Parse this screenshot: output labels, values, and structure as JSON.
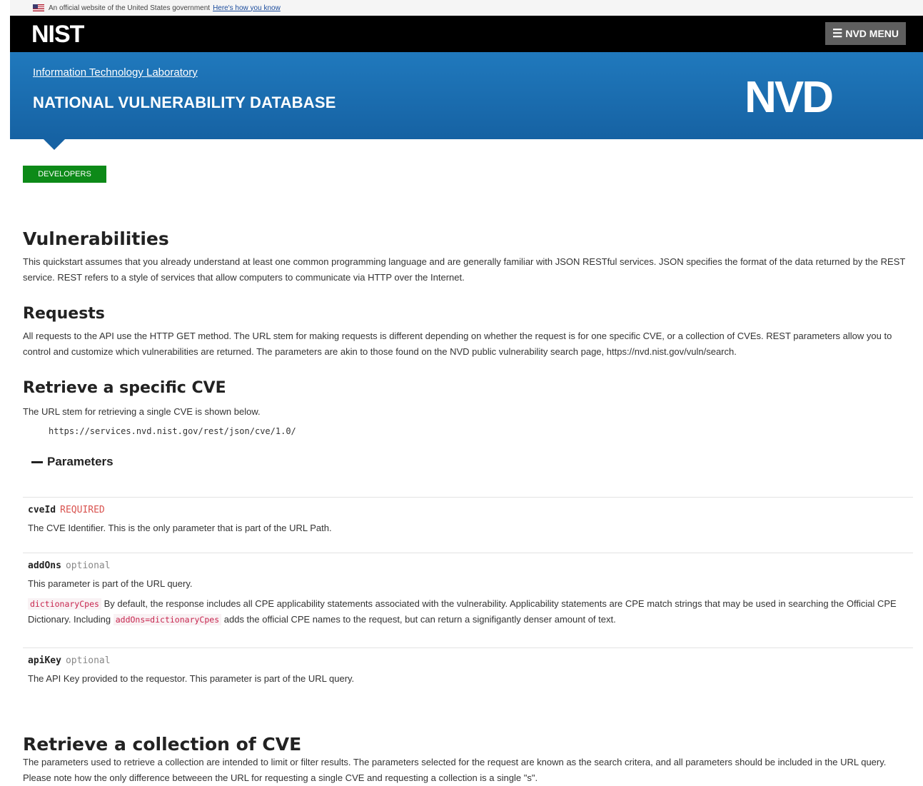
{
  "gov_banner": {
    "text": "An official website of the United States government",
    "link": "Here's how you know"
  },
  "topbar": {
    "logo": "NIST",
    "menu_label": "NVD MENU"
  },
  "header": {
    "lab_link": "Information Technology Laboratory",
    "title": "NATIONAL VULNERABILITY DATABASE",
    "logo": "NVD"
  },
  "breadcrumb_badge": "DEVELOPERS",
  "sections": {
    "vulnerabilities": {
      "heading": "Vulnerabilities",
      "body": "This quickstart assumes that you already understand at least one common programming language and are generally familiar with JSON RESTful services. JSON specifies the format of the data returned by the REST service. REST refers to a style of services that allow computers to communicate via HTTP over the Internet."
    },
    "requests": {
      "heading": "Requests",
      "body": "All requests to the API use the HTTP GET method. The URL stem for making requests is different depending on whether the request is for one specific CVE, or a collection of CVEs. REST parameters allow you to control and customize which vulnerabilities are returned. The parameters are akin to those found on the NVD public vulnerability search page, https://nvd.nist.gov/vuln/search."
    },
    "specific": {
      "heading": "Retrieve a specific CVE",
      "body": "The URL stem for retrieving a single CVE is shown below.",
      "url": "https://services.nvd.nist.gov/rest/json/cve/1.0/",
      "params_label": "Parameters"
    },
    "collection": {
      "heading": "Retrieve a collection of CVE",
      "body": "The parameters used to retrieve a collection are intended to limit or filter results. The parameters selected for the request are known as the search critera, and all parameters should be included in the URL query. Please note how the only difference betweeen the URL for requesting a single CVE and requesting a collection is a single \"s\"."
    }
  },
  "parameters": {
    "cveId": {
      "name": "cveId",
      "flag": "REQUIRED",
      "desc": "The CVE Identifier. This is the only parameter that is part of the URL Path."
    },
    "addOns": {
      "name": "addOns",
      "flag": "optional",
      "desc": "This parameter is part of the URL query.",
      "detail_code": "dictionaryCpes",
      "detail_text_1": "By default, the response includes all CPE applicability statements associated with the vulnerability. Applicability statements are CPE match strings that may be used in searching the Official CPE Dictionary. Including",
      "detail_code_2": "addOns=dictionaryCpes",
      "detail_text_2": "adds the official CPE names to the request, but can return a signifigantly denser amount of text."
    },
    "apiKey": {
      "name": "apiKey",
      "flag": "optional",
      "desc": "The API Key provided to the requestor. This parameter is part of the URL query."
    }
  },
  "colors": {
    "header_blue": "#1a6eb3",
    "badge_green": "#0d8a18",
    "required_red": "#d9534f"
  }
}
